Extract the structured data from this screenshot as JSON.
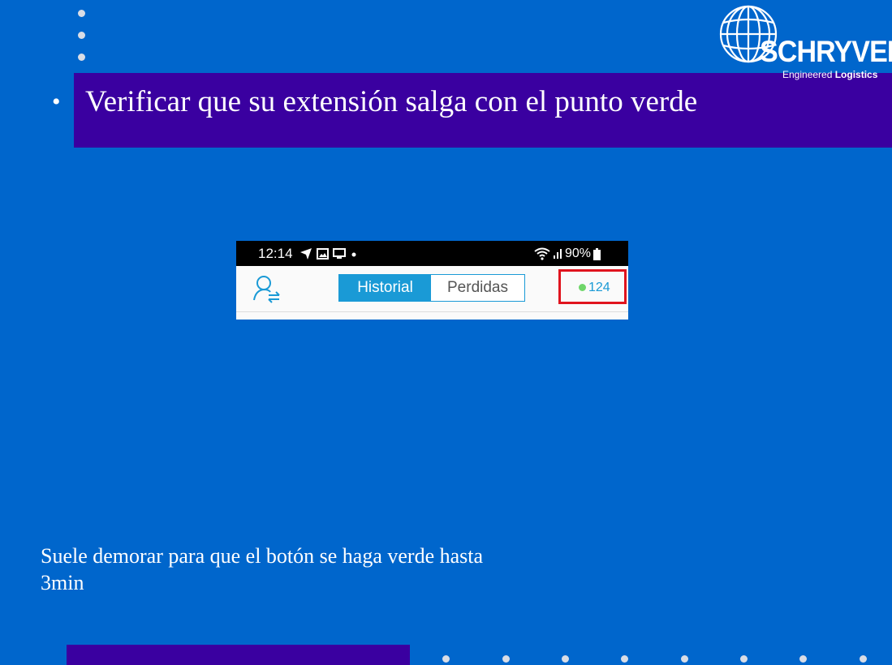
{
  "slide": {
    "bullet_char": "•",
    "title": "Verificar que su extensión salga con el punto verde",
    "footnote": "Suele demorar para que el botón se haga verde hasta 3min"
  },
  "logo": {
    "word": "SCHRYVER",
    "sub_regular": "Engineered ",
    "sub_bold": "Logistics"
  },
  "phone": {
    "time": "12:14",
    "battery": "90%",
    "left_status_icons": [
      "navigation-icon",
      "image-icon",
      "screen-icon",
      "dot-icon"
    ],
    "tabs": [
      {
        "label": "Historial",
        "active": true
      },
      {
        "label": "Perdidas",
        "active": false
      }
    ],
    "extension": {
      "number": "124",
      "status": "online",
      "status_color": "#6fd66a"
    },
    "highlight_color": "#e0141e"
  },
  "colors": {
    "background": "#0066cc",
    "band": "#3a00a0",
    "accent": "#1a9ad6"
  }
}
